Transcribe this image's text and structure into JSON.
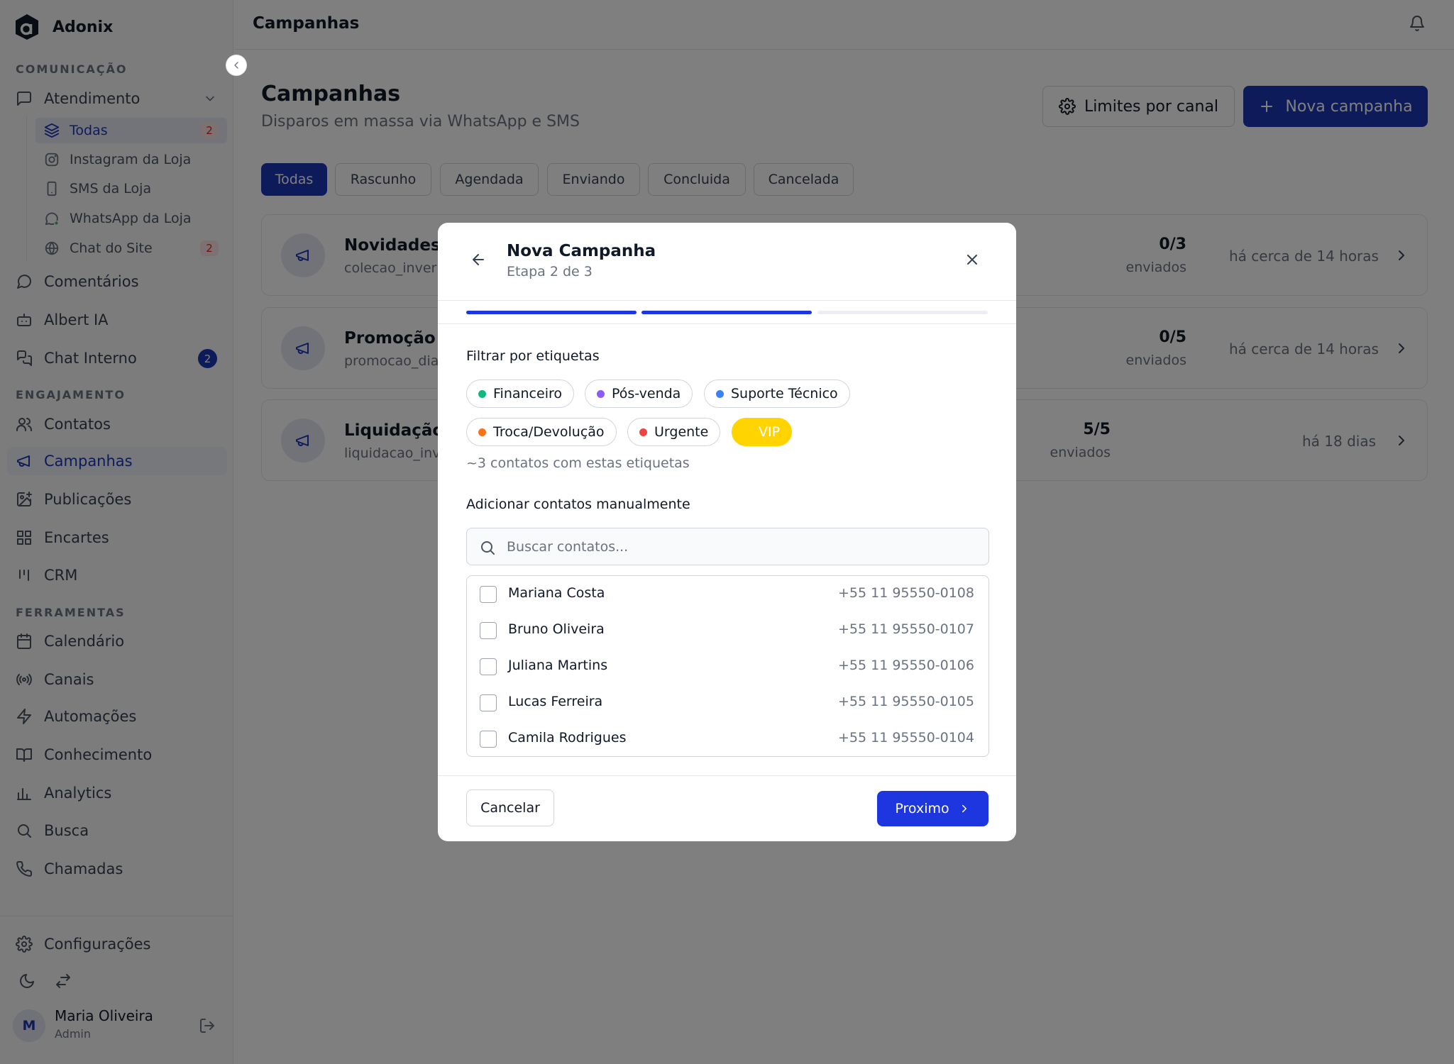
{
  "app": {
    "name": "Adonix"
  },
  "sidebar": {
    "sections": {
      "comunicacao": "COMUNICAÇÃO",
      "engajamento": "ENGAJAMENTO",
      "ferramentas": "FERRAMENTAS"
    },
    "atendimento": {
      "label": "Atendimento",
      "icon": "message-square-icon"
    },
    "sub_items": [
      {
        "label": "Todas",
        "badge": "2",
        "icon": "layers-icon",
        "active": true
      },
      {
        "label": "Instagram da Loja",
        "icon": "instagram-icon"
      },
      {
        "label": "SMS da Loja",
        "icon": "smartphone-icon"
      },
      {
        "label": "WhatsApp da Loja",
        "icon": "whatsapp-icon"
      },
      {
        "label": "Chat do Site",
        "badge": "2",
        "icon": "globe-icon"
      }
    ],
    "comunicacao_items": [
      {
        "label": "Comentários",
        "icon": "message-circle-icon"
      },
      {
        "label": "Albert IA",
        "icon": "bot-icon"
      },
      {
        "label": "Chat Interno",
        "icon": "messages-icon",
        "badge": "2"
      }
    ],
    "engajamento_items": [
      {
        "label": "Contatos",
        "icon": "users-icon"
      },
      {
        "label": "Campanhas",
        "icon": "megaphone-icon",
        "active": true
      },
      {
        "label": "Publicações",
        "icon": "image-plus-icon"
      },
      {
        "label": "Encartes",
        "icon": "grid-icon"
      },
      {
        "label": "CRM",
        "icon": "kanban-icon"
      }
    ],
    "ferramentas_items": [
      {
        "label": "Calendário",
        "icon": "calendar-icon"
      },
      {
        "label": "Canais",
        "icon": "radio-icon"
      },
      {
        "label": "Automações",
        "icon": "zap-icon"
      },
      {
        "label": "Conhecimento",
        "icon": "book-icon"
      },
      {
        "label": "Analytics",
        "icon": "bar-chart-icon"
      },
      {
        "label": "Busca",
        "icon": "search-icon"
      },
      {
        "label": "Chamadas",
        "icon": "phone-icon"
      }
    ],
    "settings": {
      "label": "Configurações",
      "icon": "gear-icon"
    },
    "user": {
      "initial": "M",
      "name": "Maria Oliveira",
      "role": "Admin"
    }
  },
  "topbar": {
    "title": "Campanhas"
  },
  "page": {
    "title": "Campanhas",
    "subtitle": "Disparos em massa via WhatsApp e SMS",
    "limits_button": "Limites por canal",
    "new_button": "Nova campanha",
    "filters": [
      "Todas",
      "Rascunho",
      "Agendada",
      "Enviando",
      "Concluida",
      "Cancelada"
    ],
    "campaigns": [
      {
        "name": "Novidades",
        "slug": "colecao_inver",
        "count": "0/3",
        "count_label": "enviados",
        "time": "há cerca de 14 horas"
      },
      {
        "name": "Promoção",
        "slug": "promocao_dia",
        "count": "0/5",
        "count_label": "enviados",
        "time": "há cerca de 14 horas"
      },
      {
        "name": "Liquidação",
        "slug": "liquidacao_inv",
        "count": "5/5",
        "count_label": "enviados",
        "time": "há 18 dias"
      }
    ]
  },
  "modal": {
    "title": "Nova Campanha",
    "step_label": "Etapa 2 de 3",
    "steps_total": 3,
    "steps_done": 2,
    "tags_label": "Filtrar por etiquetas",
    "tags": [
      {
        "label": "Financeiro",
        "color": "#10b981"
      },
      {
        "label": "Pós-venda",
        "color": "#8b5cf6"
      },
      {
        "label": "Suporte Técnico",
        "color": "#3b82f6"
      },
      {
        "label": "Troca/Devolução",
        "color": "#f97316"
      },
      {
        "label": "Urgente",
        "color": "#ef4444"
      },
      {
        "label": "VIP",
        "color": "#ffd400",
        "selected": true
      }
    ],
    "tags_hint": "~3 contatos com estas etiquetas",
    "manual_label": "Adicionar contatos manualmente",
    "search_placeholder": "Buscar contatos...",
    "contacts": [
      {
        "name": "Mariana Costa",
        "phone": "+55 11 95550-0108"
      },
      {
        "name": "Bruno Oliveira",
        "phone": "+55 11 95550-0107"
      },
      {
        "name": "Juliana Martins",
        "phone": "+55 11 95550-0106"
      },
      {
        "name": "Lucas Ferreira",
        "phone": "+55 11 95550-0105"
      },
      {
        "name": "Camila Rodrigues",
        "phone": "+55 11 95550-0104"
      }
    ],
    "cancel_button": "Cancelar",
    "next_button": "Proximo"
  },
  "colors": {
    "primary": "#1d36b4",
    "primary_bright": "#1d36e0",
    "vip": "#ffd400"
  }
}
